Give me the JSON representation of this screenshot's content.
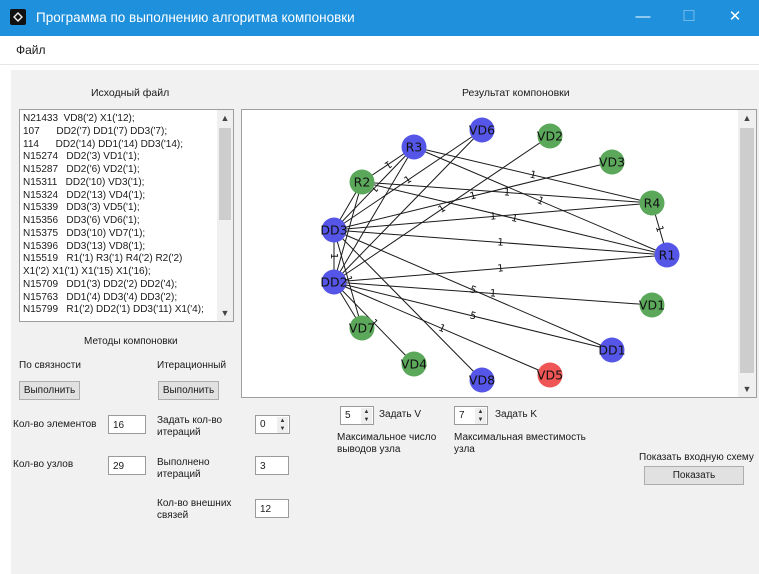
{
  "window": {
    "title": "Программа по выполнению алгоритма компоновки",
    "minimize": "—",
    "maximize": "☐",
    "close": "✕"
  },
  "menu": {
    "file": "Файл"
  },
  "source": {
    "header": "Исходный файл",
    "lines": [
      "N21433  VD8('2) X1('12);",
      "107      DD2('7) DD1('7) DD3('7);",
      "114      DD2('14) DD1('14) DD3('14);",
      "N15274   DD2('3) VD1('1);",
      "N15287   DD2('6) VD2('1);",
      "N15311   DD2('10) VD3('1);",
      "N15324   DD2('13) VD4('1);",
      "N15339   DD3('3) VD5('1);",
      "N15356   DD3('6) VD6('1);",
      "N15375   DD3('10) VD7('1);",
      "N15396   DD3('13) VD8('1);",
      "N15519   R1('1) R3('1) R4('2) R2('2)",
      "X1('2) X1('1) X1('15) X1('16);",
      "N15709   DD1('3) DD2('2) DD2('4);",
      "N15763   DD1('4) DD3('4) DD3('2);",
      "N15799   R1('2) DD2('1) DD3('11) X1('4);"
    ]
  },
  "result": {
    "header": "Результат компоновки",
    "nodes": [
      {
        "id": "VD6",
        "color": "#5555e8"
      },
      {
        "id": "VD2",
        "color": "#5ba85b"
      },
      {
        "id": "R3",
        "color": "#5555e8"
      },
      {
        "id": "VD3",
        "color": "#5ba85b"
      },
      {
        "id": "R2",
        "color": "#5ba85b"
      },
      {
        "id": "R4",
        "color": "#5ba85b"
      },
      {
        "id": "DD3",
        "color": "#5555e8"
      },
      {
        "id": "R1",
        "color": "#5555e8"
      },
      {
        "id": "DD2",
        "color": "#5555e8"
      },
      {
        "id": "VD1",
        "color": "#5ba85b"
      },
      {
        "id": "VD7",
        "color": "#5ba85b"
      },
      {
        "id": "DD1",
        "color": "#5555e8"
      },
      {
        "id": "VD4",
        "color": "#5ba85b"
      },
      {
        "id": "VD5",
        "color": "#f05555"
      },
      {
        "id": "VD8",
        "color": "#5555e8"
      }
    ],
    "edges": [
      {
        "a": "R3",
        "b": "R4",
        "label": "1"
      },
      {
        "a": "R3",
        "b": "R1",
        "label": "1"
      },
      {
        "a": "R3",
        "b": "R2",
        "label": "1"
      },
      {
        "a": "R3",
        "b": "DD3",
        "label": "1"
      },
      {
        "a": "R3",
        "b": "DD2",
        "label": ""
      },
      {
        "a": "R2",
        "b": "R4",
        "label": "1"
      },
      {
        "a": "R2",
        "b": "R1",
        "label": "1"
      },
      {
        "a": "R2",
        "b": "DD3",
        "label": ""
      },
      {
        "a": "R2",
        "b": "DD2",
        "label": ""
      },
      {
        "a": "DD3",
        "b": "VD3",
        "label": "1"
      },
      {
        "a": "DD3",
        "b": "R4",
        "label": "1"
      },
      {
        "a": "DD3",
        "b": "R1",
        "label": "1"
      },
      {
        "a": "DD3",
        "b": "VD6",
        "label": "1"
      },
      {
        "a": "DD3",
        "b": "VD7",
        "label": "1"
      },
      {
        "a": "DD3",
        "b": "VD8",
        "label": ""
      },
      {
        "a": "DD3",
        "b": "DD2",
        "label": "1"
      },
      {
        "a": "DD3",
        "b": "DD1",
        "label": "5"
      },
      {
        "a": "DD2",
        "b": "VD2",
        "label": "1"
      },
      {
        "a": "DD2",
        "b": "R1",
        "label": "1"
      },
      {
        "a": "DD2",
        "b": "VD1",
        "label": "1"
      },
      {
        "a": "DD2",
        "b": "DD1",
        "label": "5"
      },
      {
        "a": "DD2",
        "b": "VD4",
        "label": "1"
      },
      {
        "a": "DD2",
        "b": "VD5",
        "label": "1"
      },
      {
        "a": "DD2",
        "b": "VD6",
        "label": ""
      },
      {
        "a": "DD2",
        "b": "VD7",
        "label": ""
      },
      {
        "a": "R4",
        "b": "R1",
        "label": "1"
      }
    ]
  },
  "methods": {
    "header": "Методы компоновки",
    "connectivity": {
      "label": "По связности",
      "button": "Выполнить"
    },
    "iterative": {
      "label": "Итерационный",
      "button": "Выполнить"
    }
  },
  "params": {
    "elements_label": "Кол-во элементов",
    "elements_value": "16",
    "nodes_label": "Кол-во узлов",
    "nodes_value": "29",
    "set_iterations_label": "Задать кол-во итераций",
    "set_iterations_value": "0",
    "done_iterations_label": "Выполнено итераций",
    "done_iterations_value": "3",
    "external_links_label": "Кол-во внешних связей",
    "external_links_value": "12",
    "v_value": "5",
    "v_button": "Задать V",
    "v_caption": "Максимальное число выводов узла",
    "k_value": "7",
    "k_button": "Задать K",
    "k_caption": "Максимальная вместимость узла",
    "show_label": "Показать входную схему",
    "show_button": "Показать"
  }
}
